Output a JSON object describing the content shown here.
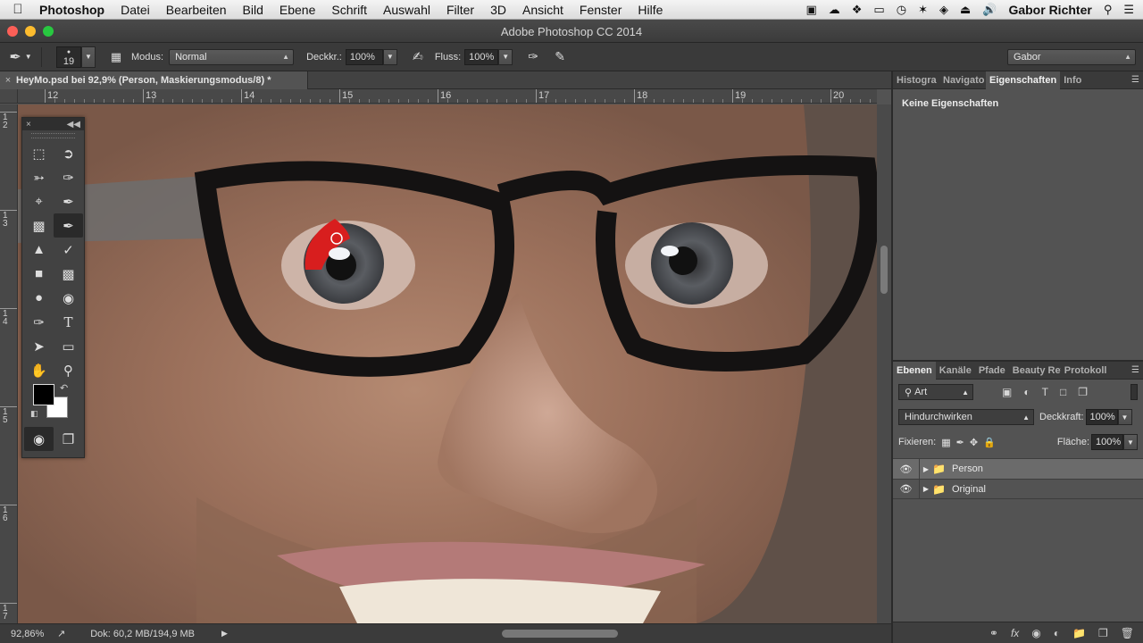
{
  "menubar": {
    "app_name": "Photoshop",
    "items": [
      "Datei",
      "Bearbeiten",
      "Bild",
      "Ebene",
      "Schrift",
      "Auswahl",
      "Filter",
      "3D",
      "Ansicht",
      "Fenster",
      "Hilfe"
    ],
    "user": "Gabor Richter"
  },
  "window": {
    "title": "Adobe Photoshop CC 2014"
  },
  "options": {
    "brush_size": "19",
    "modus_label": "Modus:",
    "modus_value": "Normal",
    "deckkraft_label": "Deckkr.:",
    "deckkraft_value": "100%",
    "fluss_label": "Fluss:",
    "fluss_value": "100%",
    "workspace": "Gabor"
  },
  "document": {
    "tab_title": "HeyMo.psd bei 92,9% (Person, Maskierungsmodus/8) *",
    "close": "×"
  },
  "ruler": {
    "h_labels": [
      "12",
      "13",
      "14",
      "15",
      "16",
      "17",
      "18",
      "19",
      "20"
    ],
    "v_labels": [
      "1",
      "2",
      "1",
      "3",
      "1",
      "4",
      "1",
      "5",
      "1",
      "6",
      "1",
      "7"
    ]
  },
  "status": {
    "zoom": "92,86%",
    "doc": "Dok: 60,2 MB/194,9 MB"
  },
  "properties_panel": {
    "tabs": [
      "Histogra",
      "Navigato",
      "Eigenschaften",
      "Info"
    ],
    "active_tab": "Eigenschaften",
    "message": "Keine Eigenschaften"
  },
  "layers_panel": {
    "tabs": [
      "Ebenen",
      "Kanäle",
      "Pfade",
      "Beauty Ret",
      "Protokoll"
    ],
    "active_tab": "Ebenen",
    "filter": "Art",
    "blend_mode": "Hindurchwirken",
    "opacity_label": "Deckkraft:",
    "opacity_value": "100%",
    "lock_label": "Fixieren:",
    "fill_label": "Fläche:",
    "fill_value": "100%",
    "layers": [
      {
        "name": "Person",
        "selected": true
      },
      {
        "name": "Original",
        "selected": false
      }
    ]
  },
  "colors": {
    "foreground": "#000000",
    "background": "#ffffff",
    "mask_red": "#d81e1e"
  }
}
